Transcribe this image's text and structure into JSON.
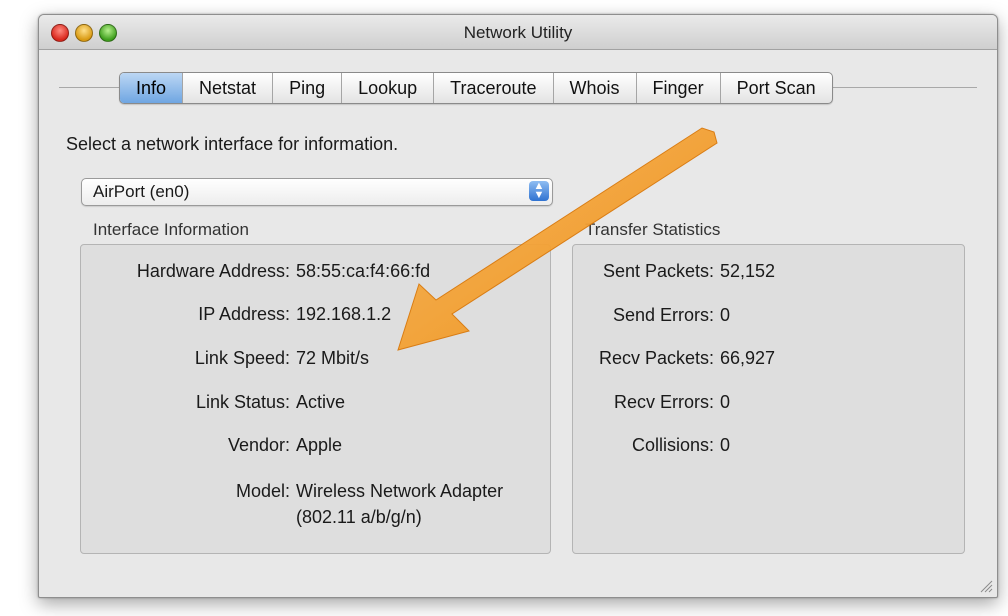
{
  "window": {
    "title": "Network Utility"
  },
  "tabs": [
    {
      "label": "Info",
      "active": true
    },
    {
      "label": "Netstat"
    },
    {
      "label": "Ping"
    },
    {
      "label": "Lookup"
    },
    {
      "label": "Traceroute"
    },
    {
      "label": "Whois"
    },
    {
      "label": "Finger"
    },
    {
      "label": "Port Scan"
    }
  ],
  "info": {
    "prompt": "Select a network interface for information.",
    "selected_interface": "AirPort (en0)"
  },
  "interface_information": {
    "title": "Interface Information",
    "hardware_address": {
      "label": "Hardware Address:",
      "value": "58:55:ca:f4:66:fd"
    },
    "ip_address": {
      "label": "IP Address:",
      "value": "192.168.1.2"
    },
    "link_speed": {
      "label": "Link Speed:",
      "value": "72 Mbit/s"
    },
    "link_status": {
      "label": "Link Status:",
      "value": "Active"
    },
    "vendor": {
      "label": "Vendor:",
      "value": "Apple"
    },
    "model": {
      "label": "Model:",
      "value_line1": "Wireless Network Adapter",
      "value_line2": "(802.11 a/b/g/n)"
    }
  },
  "transfer_statistics": {
    "title": "Transfer Statistics",
    "sent_packets": {
      "label": "Sent Packets:",
      "value": "52,152"
    },
    "send_errors": {
      "label": "Send Errors:",
      "value": "0"
    },
    "recv_packets": {
      "label": "Recv Packets:",
      "value": "66,927"
    },
    "recv_errors": {
      "label": "Recv Errors:",
      "value": "0"
    },
    "collisions": {
      "label": "Collisions:",
      "value": "0"
    }
  },
  "colors": {
    "annotation_arrow": "#f39a1e",
    "active_tab": "#6fa6e2",
    "close_button": "#d9271c",
    "minimize_button": "#d99a12",
    "zoom_button": "#3f9f1d"
  }
}
